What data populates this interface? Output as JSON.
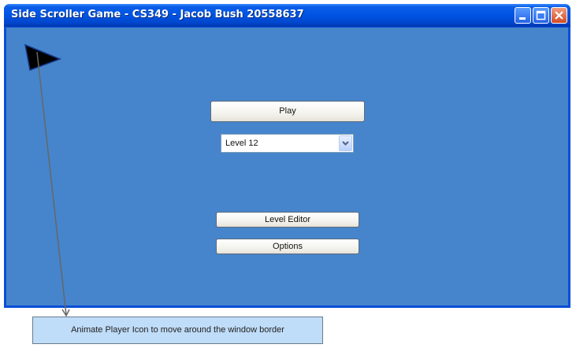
{
  "window": {
    "title": "Side Scroller Game - CS349 - Jacob Bush 20558637",
    "controls": [
      "minimize",
      "maximize",
      "close"
    ]
  },
  "menu": {
    "play_label": "Play",
    "level_select": {
      "selected": "Level 12"
    },
    "level_editor_label": "Level Editor",
    "options_label": "Options"
  },
  "player_icon": {
    "icon": "triangle-flag-icon",
    "color": "#000000"
  },
  "annotation": {
    "text": "Animate Player Icon to move around the window border"
  },
  "colors": {
    "client_bg": "#4685cc",
    "titlebar": "#0055e5",
    "note_bg": "#bfdcf8"
  }
}
